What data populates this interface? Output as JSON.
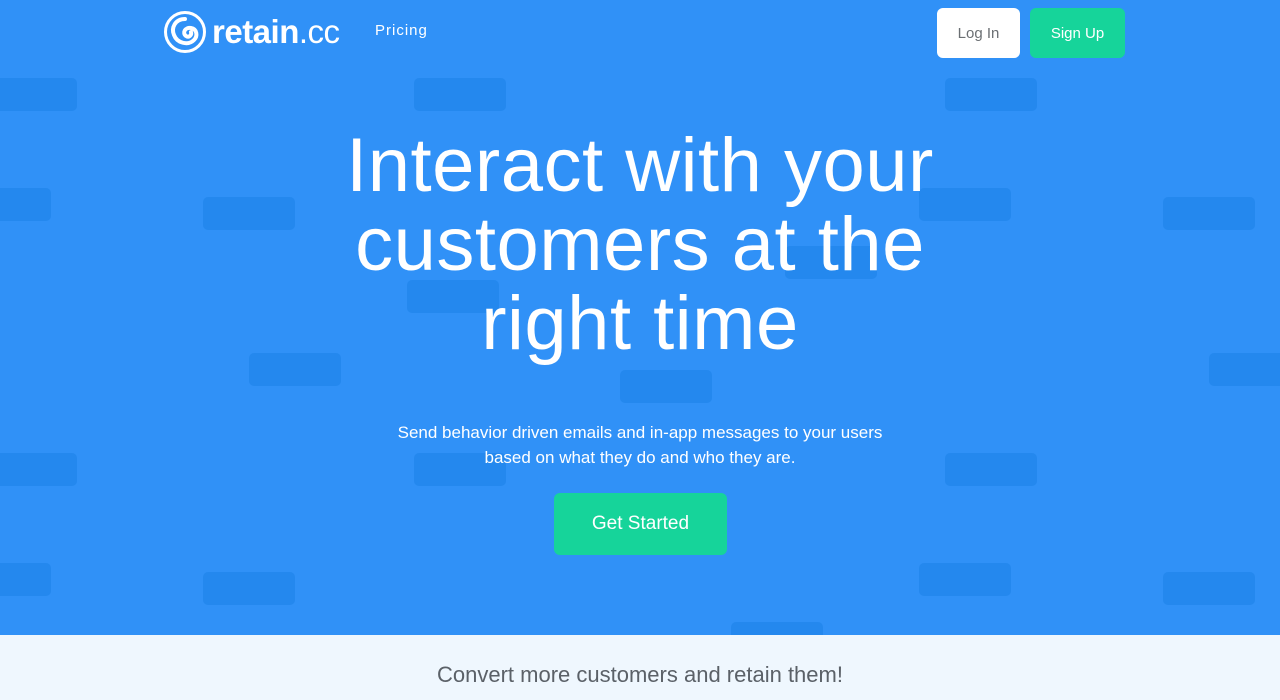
{
  "brand": {
    "name_bold": "retain",
    "name_light": ".cc",
    "logo_icon": "swirl-logo-icon"
  },
  "nav": {
    "links": [
      {
        "label": "Pricing"
      }
    ],
    "login_label": "Log In",
    "signup_label": "Sign Up"
  },
  "hero": {
    "headline": "Interact with your customers at the right time",
    "subtext": "Send behavior driven emails and in-app messages to your users based on what they do and who they are.",
    "cta_label": "Get Started"
  },
  "band": {
    "text": "Convert more customers and retain them!"
  },
  "colors": {
    "hero_background": "#3091f7",
    "accent_green": "#16d49a",
    "band_background": "#eff7fe"
  }
}
